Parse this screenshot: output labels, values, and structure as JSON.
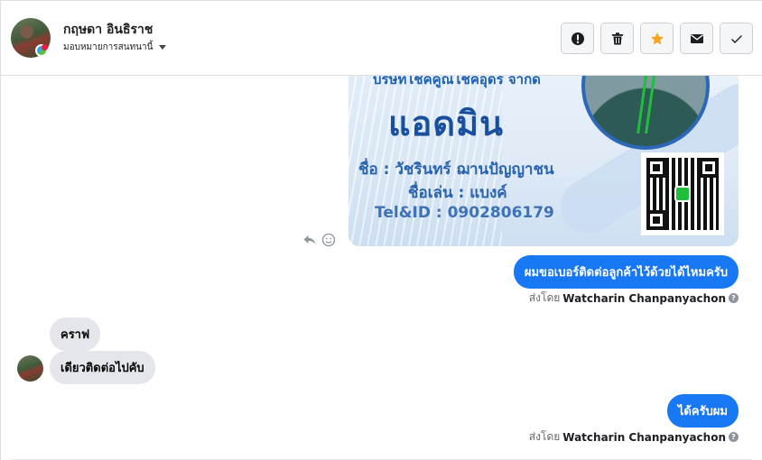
{
  "header": {
    "contact_name": "กฤษดา อินธิราช",
    "assign_label": "มอบหมายการสนทนานี้",
    "actions": [
      {
        "name": "spam-button",
        "icon": "exclamation-icon"
      },
      {
        "name": "delete-button",
        "icon": "trash-icon"
      },
      {
        "name": "star-button",
        "icon": "star-icon",
        "color": "#f5a623"
      },
      {
        "name": "mark-unread-button",
        "icon": "envelope-icon"
      },
      {
        "name": "done-button",
        "icon": "check-icon"
      }
    ]
  },
  "card": {
    "company": "บริษัทโชคคูณโชคอุดร จำกัด",
    "role": "แอดมิน",
    "name_line": "ชื่อ : วัชรินทร์ ฌานปัญญาชน",
    "nickname_line": "ชื่อเล่น : แบงค์",
    "tel_line": "Tel&ID : 0902806179"
  },
  "messages": {
    "out1": "ผมขอเบอร์ติดต่อลูกค้าไว้ด้วยได้ไหมครับ",
    "in1": "คราฟ",
    "in2": "เดียวติดต่อไปคับ",
    "out2": "ได้ครับผม"
  },
  "sent_by": {
    "prefix": "ส่งโดย",
    "sender": "Watcharin Chanpanyachon",
    "help": "?"
  },
  "colors": {
    "accent": "#1877f2",
    "incoming_bubble": "#e4e6eb",
    "star": "#f5a623"
  }
}
